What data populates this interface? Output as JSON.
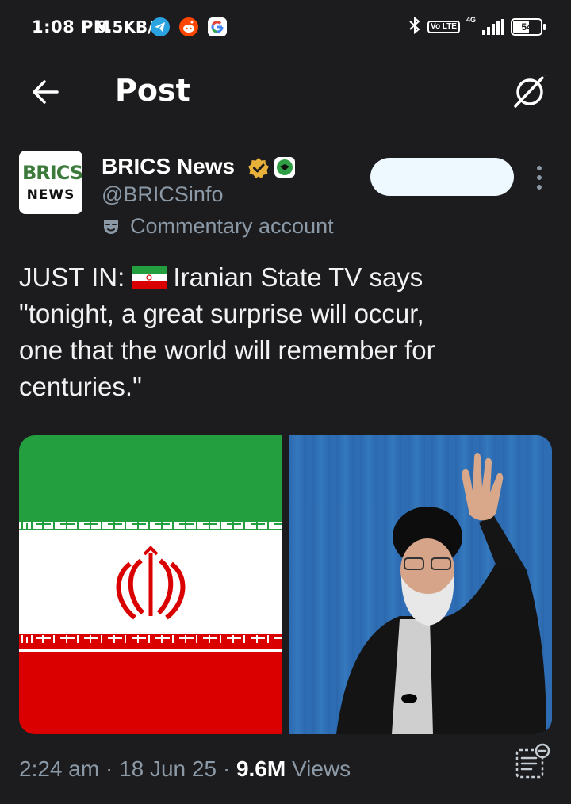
{
  "status_bar": {
    "time": "1:08 PM",
    "speed": "6.5KB/s",
    "network": "4G",
    "volte": "Vo LTE",
    "battery": "54"
  },
  "header": {
    "title": "Post"
  },
  "author": {
    "avatar_top": "BRICS",
    "avatar_bottom": "NEWS",
    "name": "BRICS News",
    "handle": "@BRICSinfo",
    "label": "Commentary account"
  },
  "post": {
    "lines": [
      "JUST IN:  Iranian State TV says",
      "\"tonight, a great surprise will occur,",
      "one that the world will remember for",
      "centuries.\""
    ],
    "prefix": "JUST IN:",
    "first_line_rest": "Iranian State TV says"
  },
  "footer": {
    "time": "2:24 am",
    "sep1": "·",
    "date": "18 Jun 25",
    "sep2": "·",
    "views_count": "9.6M",
    "views_label": "Views"
  },
  "colors": {
    "background": "#1c1c1e",
    "secondary_text": "#8b98a5",
    "verified": "#e8b23a",
    "flag_green": "#239f40",
    "flag_red": "#da0000"
  }
}
